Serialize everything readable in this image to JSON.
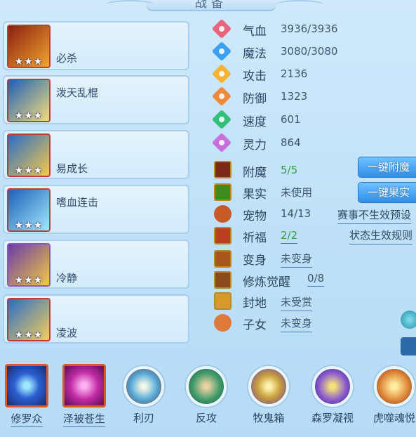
{
  "title": "战备",
  "slots": [
    {
      "name": "必杀",
      "stars": "★★★",
      "colors": [
        "#8d1f12",
        "#f0a52b"
      ]
    },
    {
      "name": "泼天乱棍",
      "stars": "★★★",
      "colors": [
        "#1f5fb8",
        "#f2dd7a"
      ]
    },
    {
      "name": "易成长",
      "stars": "★★★",
      "colors": [
        "#2a6cc8",
        "#f3c94a"
      ]
    },
    {
      "name": "嗜血连击",
      "stars": "★★★",
      "colors": [
        "#1f5fb8",
        "#9fe8ff"
      ]
    },
    {
      "name": "冷静",
      "stars": "★★★",
      "colors": [
        "#6a3ca6",
        "#f1c845"
      ]
    },
    {
      "name": "凌波",
      "stars": "★★★",
      "colors": [
        "#2a6cc8",
        "#f2cf58"
      ]
    }
  ],
  "stats": [
    {
      "label": "气血",
      "value": "3936/3936",
      "icon": "heart-icon",
      "color": "#e8647a"
    },
    {
      "label": "魔法",
      "value": "3080/3080",
      "icon": "mana-icon",
      "color": "#3aa0f0"
    },
    {
      "label": "攻击",
      "value": "2136",
      "icon": "sword-icon",
      "color": "#f5b233"
    },
    {
      "label": "防御",
      "value": "1323",
      "icon": "shield-icon",
      "color": "#f08a3a"
    },
    {
      "label": "速度",
      "value": "601",
      "icon": "speed-icon",
      "color": "#33c07a"
    },
    {
      "label": "灵力",
      "value": "864",
      "icon": "spirit-icon",
      "color": "#c86fe0"
    }
  ],
  "info": {
    "enchant": {
      "label": "附魔",
      "value": "5/5"
    },
    "fruit": {
      "label": "果实",
      "value": "未使用"
    },
    "pet": {
      "label": "宠物",
      "value": "14/13"
    },
    "bless": {
      "label": "祈福",
      "value": "2/2"
    },
    "transform": {
      "label": "变身",
      "value": "未变身"
    },
    "awaken": {
      "label": "修炼觉醒",
      "value": "0/8"
    },
    "fief": {
      "label": "封地",
      "value": "未受赏"
    },
    "children": {
      "label": "子女",
      "value": "未变身"
    }
  },
  "buttons": {
    "enchant_all": "一键附魔",
    "fruit_all": "一键果实"
  },
  "links": {
    "event_preset": "赛事不生效预设",
    "state_rules": "状态生效规则"
  },
  "skills": [
    {
      "label": "修罗众",
      "shape": "square",
      "color": "#2b5fd1"
    },
    {
      "label": "泽被苍生",
      "shape": "square",
      "color": "#c02aa3"
    },
    {
      "label": "利刃",
      "shape": "round",
      "color": "#4fa6d6"
    },
    {
      "label": "反攻",
      "shape": "round",
      "color": "#3f9a6b"
    },
    {
      "label": "牧鬼箱",
      "shape": "round",
      "color": "#c9a23c"
    },
    {
      "label": "森罗凝视",
      "shape": "round",
      "color": "#8a5bd0"
    },
    {
      "label": "虎噬魂悦",
      "shape": "round",
      "color": "#e0883a"
    }
  ]
}
